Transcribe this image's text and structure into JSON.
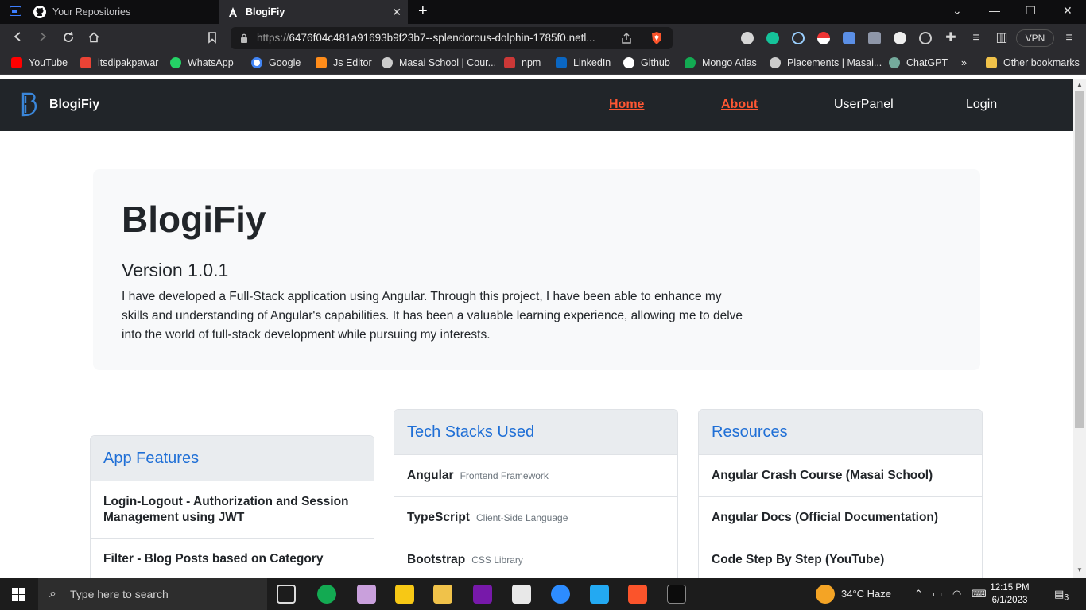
{
  "browser": {
    "tabs": [
      {
        "title": "Your Repositories",
        "icon": "github-icon"
      },
      {
        "title": "BlogiFiy",
        "icon": "angular-icon"
      }
    ],
    "url_protocol": "https://",
    "url_rest": "6476f04c481a91693b9f23b7--splendorous-dolphin-1785f0.netl...",
    "vpn_label": "VPN",
    "bookmarks": [
      "YouTube",
      "itsdipakpawar",
      "WhatsApp",
      "Google",
      "Js Editor",
      "Masai School | Cour...",
      "npm",
      "LinkedIn",
      "Github",
      "Mongo Atlas",
      "Placements | Masai...",
      "ChatGPT"
    ],
    "bookmarks_overflow": "»",
    "other_bookmarks": "Other bookmarks"
  },
  "navbar": {
    "brand": "BlogiFiy",
    "links": [
      "Home",
      "About",
      "UserPanel",
      "Login"
    ]
  },
  "hero": {
    "title": "BlogiFiy",
    "version": "Version 1.0.1",
    "description": "I have developed a Full-Stack application using Angular. Through this project, I have been able to enhance my skills and understanding of Angular's capabilities. It has been a valuable learning experience, allowing me to delve into the world of full-stack development while pursuing my interests."
  },
  "cards": {
    "features": {
      "title": "App Features",
      "items": [
        "Login-Logout - Authorization and Session Management using JWT",
        "Filter - Blog Posts based on Category"
      ]
    },
    "tech": {
      "title": "Tech Stacks Used",
      "items": [
        {
          "name": "Angular",
          "desc": "Frontend Framework"
        },
        {
          "name": "TypeScript",
          "desc": "Client-Side Language"
        },
        {
          "name": "Bootstrap",
          "desc": "CSS Library"
        }
      ]
    },
    "resources": {
      "title": "Resources",
      "items": [
        "Angular Crash Course (Masai School)",
        "Angular Docs (Official Documentation)",
        "Code Step By Step (YouTube)"
      ]
    }
  },
  "taskbar": {
    "search_placeholder": "Type here to search",
    "weather": "34°C  Haze",
    "time": "12:15 PM",
    "date": "6/1/2023",
    "notifications": "3"
  },
  "colors": {
    "nav_bg": "#212529",
    "active_link": "#ff5733",
    "card_title": "#1f6fd6",
    "hero_bg": "#f8f9fa"
  }
}
